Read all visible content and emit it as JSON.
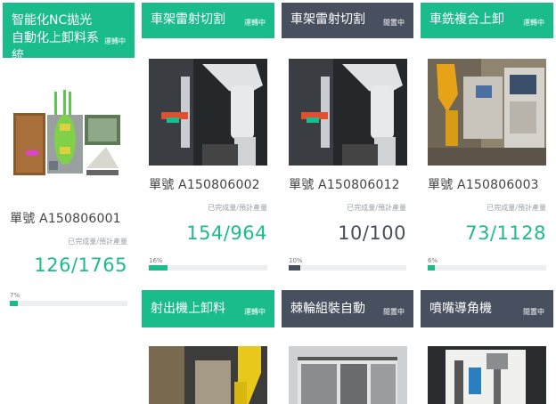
{
  "colors": {
    "running": "#1abc8c",
    "idle": "#484f5e"
  },
  "progress_label": "已完成量/預計產量",
  "machines": [
    {
      "name": "智能化NC拋光 自動化上卸料系統",
      "status": "運轉中",
      "status_type": "running",
      "order": "單號 A150806001",
      "progress": "126/1765",
      "percent_label": "7%",
      "percent": 0.07
    },
    {
      "name": "車架雷射切割",
      "status": "運轉中",
      "status_type": "running",
      "order": "單號 A150806002",
      "progress": "154/964",
      "percent_label": "16%",
      "percent": 0.16
    },
    {
      "name": "車架雷射切割",
      "status": "閒置中",
      "status_type": "idle",
      "order": "單號 A150806012",
      "progress": "10/100",
      "percent_label": "10%",
      "percent": 0.1
    },
    {
      "name": "車銑複合上卸",
      "status": "運轉中",
      "status_type": "running",
      "order": "單號 A150806003",
      "progress": "73/1128",
      "percent_label": "6%",
      "percent": 0.06
    },
    {
      "name": "射出機上卸料",
      "status": "運轉中",
      "status_type": "running"
    },
    {
      "name": "棘輪組裝自動",
      "status": "閒置中",
      "status_type": "idle"
    },
    {
      "name": "噴嘴導角機",
      "status": "閒置中",
      "status_type": "idle"
    }
  ]
}
